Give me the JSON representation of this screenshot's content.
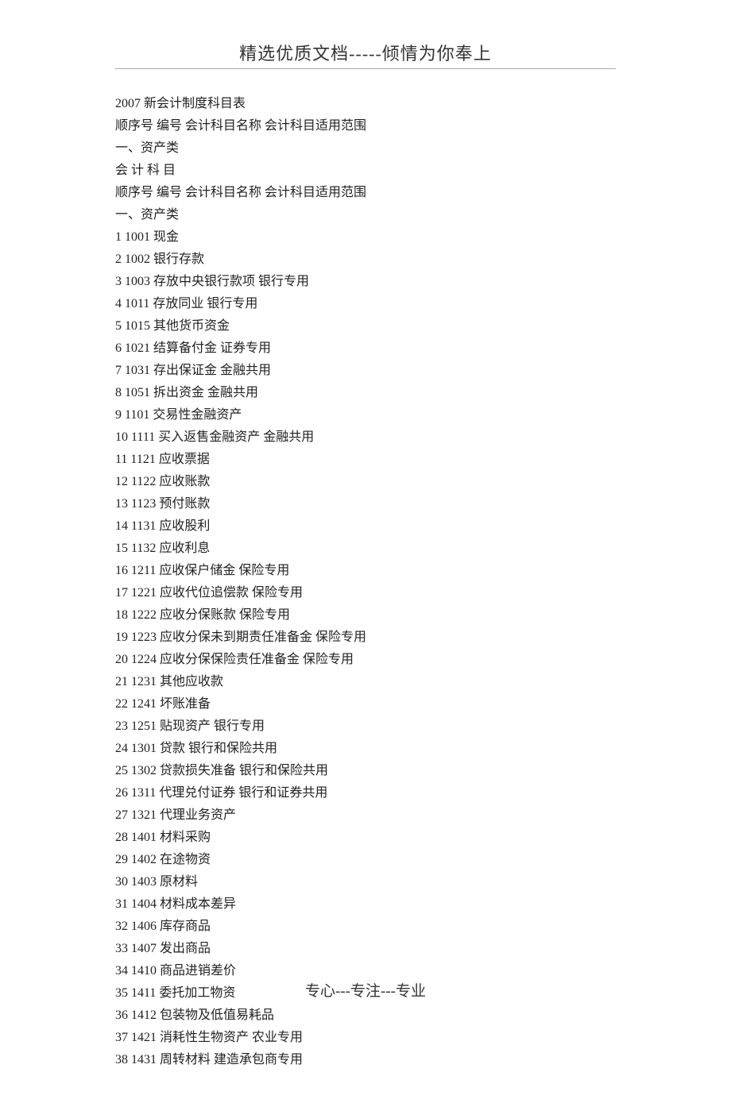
{
  "header": {
    "title": "精选优质文档-----倾情为你奉上"
  },
  "content": {
    "lines": [
      "2007 新会计制度科目表",
      "顺序号 编号 会计科目名称 会计科目适用范围",
      "一、资产类",
      "会 计 科 目",
      "顺序号 编号 会计科目名称 会计科目适用范围",
      "一、资产类",
      "1 1001 现金",
      "2 1002 银行存款",
      "3 1003 存放中央银行款项 银行专用",
      "4 1011 存放同业 银行专用",
      "5 1015 其他货币资金",
      "6 1021 结算备付金 证券专用",
      "7 1031 存出保证金 金融共用",
      "8 1051 拆出资金 金融共用",
      "9 1101 交易性金融资产",
      "10 1111 买入返售金融资产 金融共用",
      "11 1121 应收票据",
      "12 1122 应收账款",
      "13 1123 预付账款",
      "14 1131 应收股利",
      "15 1132 应收利息",
      "16 1211 应收保户储金 保险专用",
      "17 1221 应收代位追偿款 保险专用",
      "18 1222 应收分保账款 保险专用",
      "19 1223 应收分保未到期责任准备金 保险专用",
      "20 1224 应收分保保险责任准备金 保险专用",
      "21 1231 其他应收款",
      "22 1241 坏账准备",
      "23 1251 贴现资产 银行专用",
      "24 1301 贷款 银行和保险共用",
      "25 1302 贷款损失准备 银行和保险共用",
      "26 1311 代理兑付证券 银行和证券共用",
      "27 1321 代理业务资产",
      "28 1401 材料采购",
      "29 1402 在途物资",
      "30 1403 原材料",
      "31 1404 材料成本差异",
      "32 1406 库存商品",
      "33 1407 发出商品",
      "34 1410 商品进销差价",
      "35 1411 委托加工物资",
      "36 1412 包装物及低值易耗品",
      "37 1421 消耗性生物资产 农业专用",
      "38 1431 周转材料 建造承包商专用"
    ]
  },
  "footer": {
    "text": "专心---专注---专业"
  }
}
